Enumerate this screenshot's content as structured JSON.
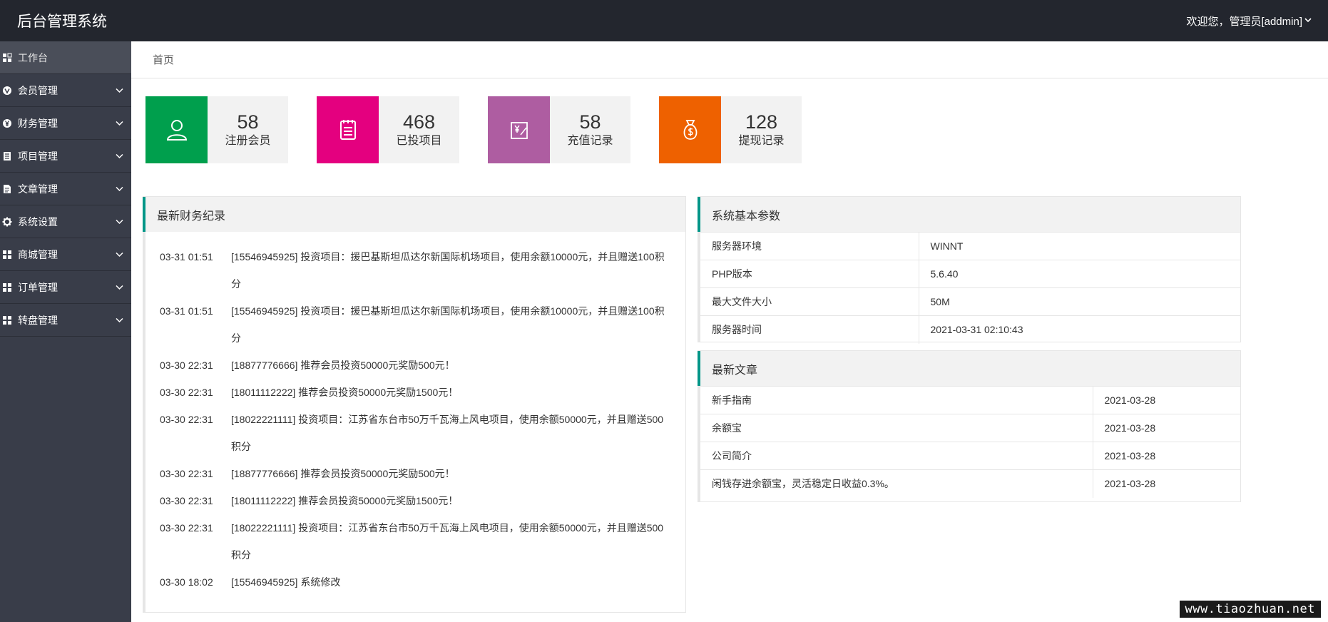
{
  "header": {
    "logo": "后台管理系统",
    "user_greeting": "欢迎您，管理员[addmin]"
  },
  "sidebar": {
    "items": [
      {
        "label": "工作台",
        "icon": "dashboard-icon"
      },
      {
        "label": "会员管理",
        "icon": "vip-icon"
      },
      {
        "label": "财务管理",
        "icon": "yen-icon"
      },
      {
        "label": "项目管理",
        "icon": "list-icon"
      },
      {
        "label": "文章管理",
        "icon": "article-icon"
      },
      {
        "label": "系统设置",
        "icon": "gear-icon"
      },
      {
        "label": "商城管理",
        "icon": "grid-icon"
      },
      {
        "label": "订单管理",
        "icon": "grid-icon"
      },
      {
        "label": "转盘管理",
        "icon": "grid-icon"
      }
    ]
  },
  "tabs": {
    "home": "首页"
  },
  "stats": [
    {
      "value": "58",
      "label": "注册会员",
      "icon": "user-icon",
      "color": "#009f4d"
    },
    {
      "value": "468",
      "label": "已投项目",
      "icon": "clipboard-icon",
      "color": "#e4007f"
    },
    {
      "value": "58",
      "label": "充值记录",
      "icon": "recharge-icon",
      "color": "#ae5da1"
    },
    {
      "value": "128",
      "label": "提现记录",
      "icon": "money-bag-icon",
      "color": "#ee6100"
    }
  ],
  "finance": {
    "title": "最新财务纪录",
    "records": [
      {
        "time": "03-31 01:51",
        "text": "[15546945925] 投资项目：援巴基斯坦瓜达尔新国际机场项目，使用余额10000元，并且赠送100积分"
      },
      {
        "time": "03-31 01:51",
        "text": "[15546945925] 投资项目：援巴基斯坦瓜达尔新国际机场项目，使用余额10000元，并且赠送100积分"
      },
      {
        "time": "03-30 22:31",
        "text": "[18877776666] 推荐会员投资50000元奖励500元！"
      },
      {
        "time": "03-30 22:31",
        "text": "[18011112222] 推荐会员投资50000元奖励1500元！"
      },
      {
        "time": "03-30 22:31",
        "text": "[18022221111] 投资项目：江苏省东台市50万千瓦海上风电项目，使用余额50000元，并且赠送500积分"
      },
      {
        "time": "03-30 22:31",
        "text": "[18877776666] 推荐会员投资50000元奖励500元！"
      },
      {
        "time": "03-30 22:31",
        "text": "[18011112222] 推荐会员投资50000元奖励1500元！"
      },
      {
        "time": "03-30 22:31",
        "text": "[18022221111] 投资项目：江苏省东台市50万千瓦海上风电项目，使用余额50000元，并且赠送500积分"
      },
      {
        "time": "03-30 18:02",
        "text": "[15546945925] 系统修改"
      }
    ]
  },
  "params": {
    "title": "系统基本参数",
    "rows": [
      {
        "key": "服务器环境",
        "value": "WINNT"
      },
      {
        "key": "PHP版本",
        "value": "5.6.40"
      },
      {
        "key": "最大文件大小",
        "value": "50M"
      },
      {
        "key": "服务器时间",
        "value": "2021-03-31 02:10:43"
      }
    ]
  },
  "articles": {
    "title": "最新文章",
    "rows": [
      {
        "title": "新手指南",
        "date": "2021-03-28"
      },
      {
        "title": "余额宝",
        "date": "2021-03-28"
      },
      {
        "title": "公司简介",
        "date": "2021-03-28"
      },
      {
        "title": "闲钱存进余额宝，灵活稳定日收益0.3%。",
        "date": "2021-03-28"
      }
    ]
  },
  "watermark": "www.tiaozhuan.net",
  "colors": {
    "topbar": "#23262e",
    "sidebar": "#393d49",
    "accent": "#009688"
  }
}
